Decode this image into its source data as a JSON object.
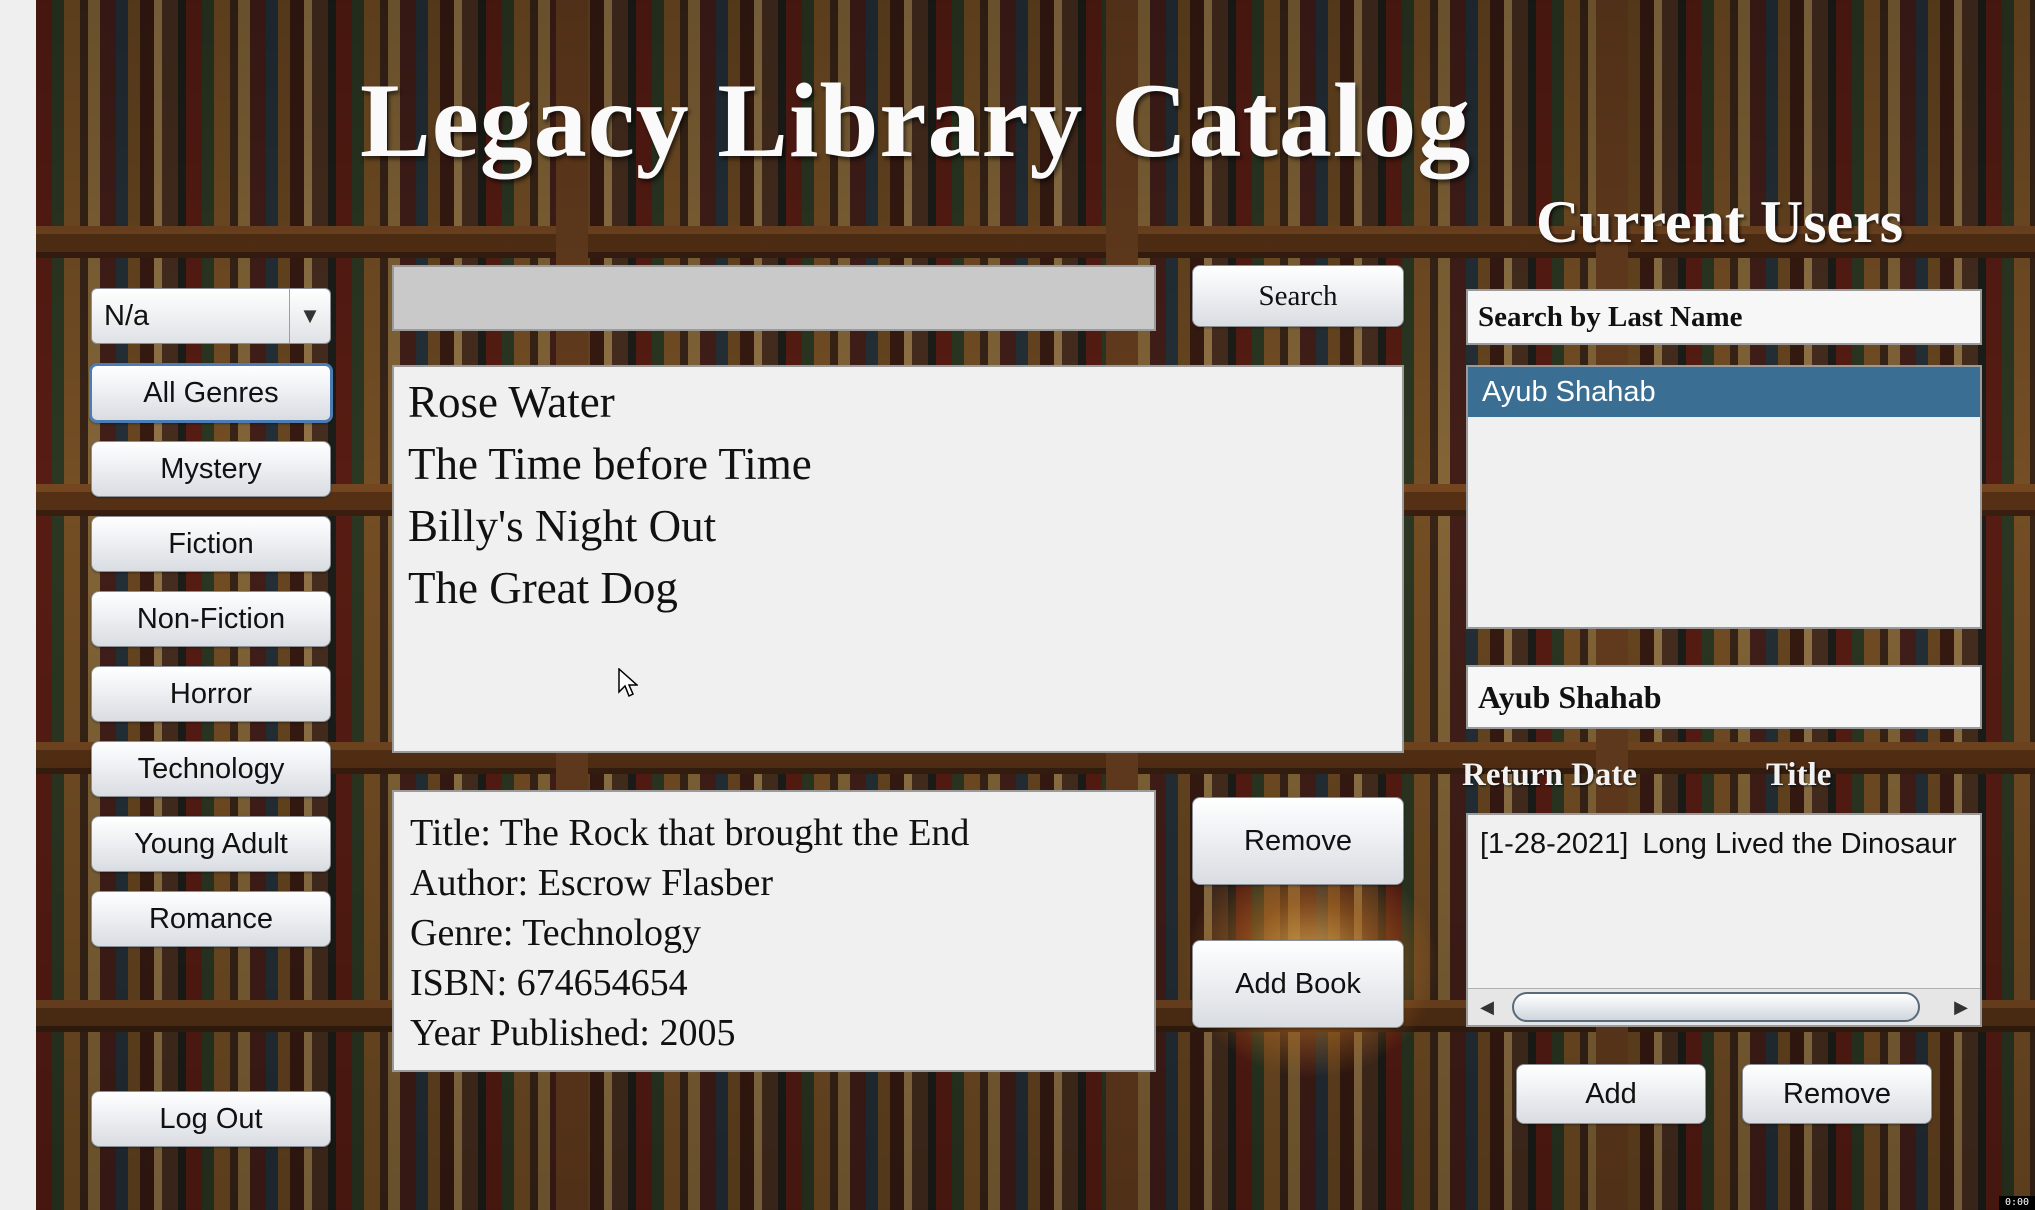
{
  "header": {
    "title": "Legacy Library Catalog"
  },
  "genre_select": {
    "value": "N/a",
    "arrow_icon": "chevron-down-icon"
  },
  "genres": {
    "all": "All Genres",
    "mystery": "Mystery",
    "fiction": "Fiction",
    "nonfiction": "Non-Fiction",
    "horror": "Horror",
    "technology": "Technology",
    "young_adult": "Young Adult",
    "romance": "Romance"
  },
  "logout_label": "Log Out",
  "search": {
    "value": "",
    "button_label": "Search"
  },
  "books": {
    "items": [
      "Rose Water",
      "The Time before Time",
      "Billy's Night Out",
      "The Great Dog"
    ]
  },
  "details": {
    "title_line": "Title: The Rock that brought the End",
    "author_line": "Author: Escrow Flasber",
    "genre_line": "Genre: Technology",
    "isbn_line": "ISBN: 674654654",
    "year_line": "Year Published: 2005"
  },
  "book_actions": {
    "remove_label": "Remove",
    "add_label": "Add Book"
  },
  "users": {
    "title": "Current Users",
    "search_placeholder": "Search by Last Name",
    "list": [
      "Ayub Shahab"
    ],
    "selected_user": "Ayub Shahab",
    "selected_color": "#3a6f93"
  },
  "loans": {
    "col_return_date": "Return Date",
    "col_title": "Title",
    "items": [
      {
        "date": "[1-28-2021]",
        "title": "Long Lived the Dinosaur"
      }
    ],
    "add_label": "Add",
    "remove_label": "Remove"
  },
  "status": {
    "corner_text": "0:00"
  }
}
